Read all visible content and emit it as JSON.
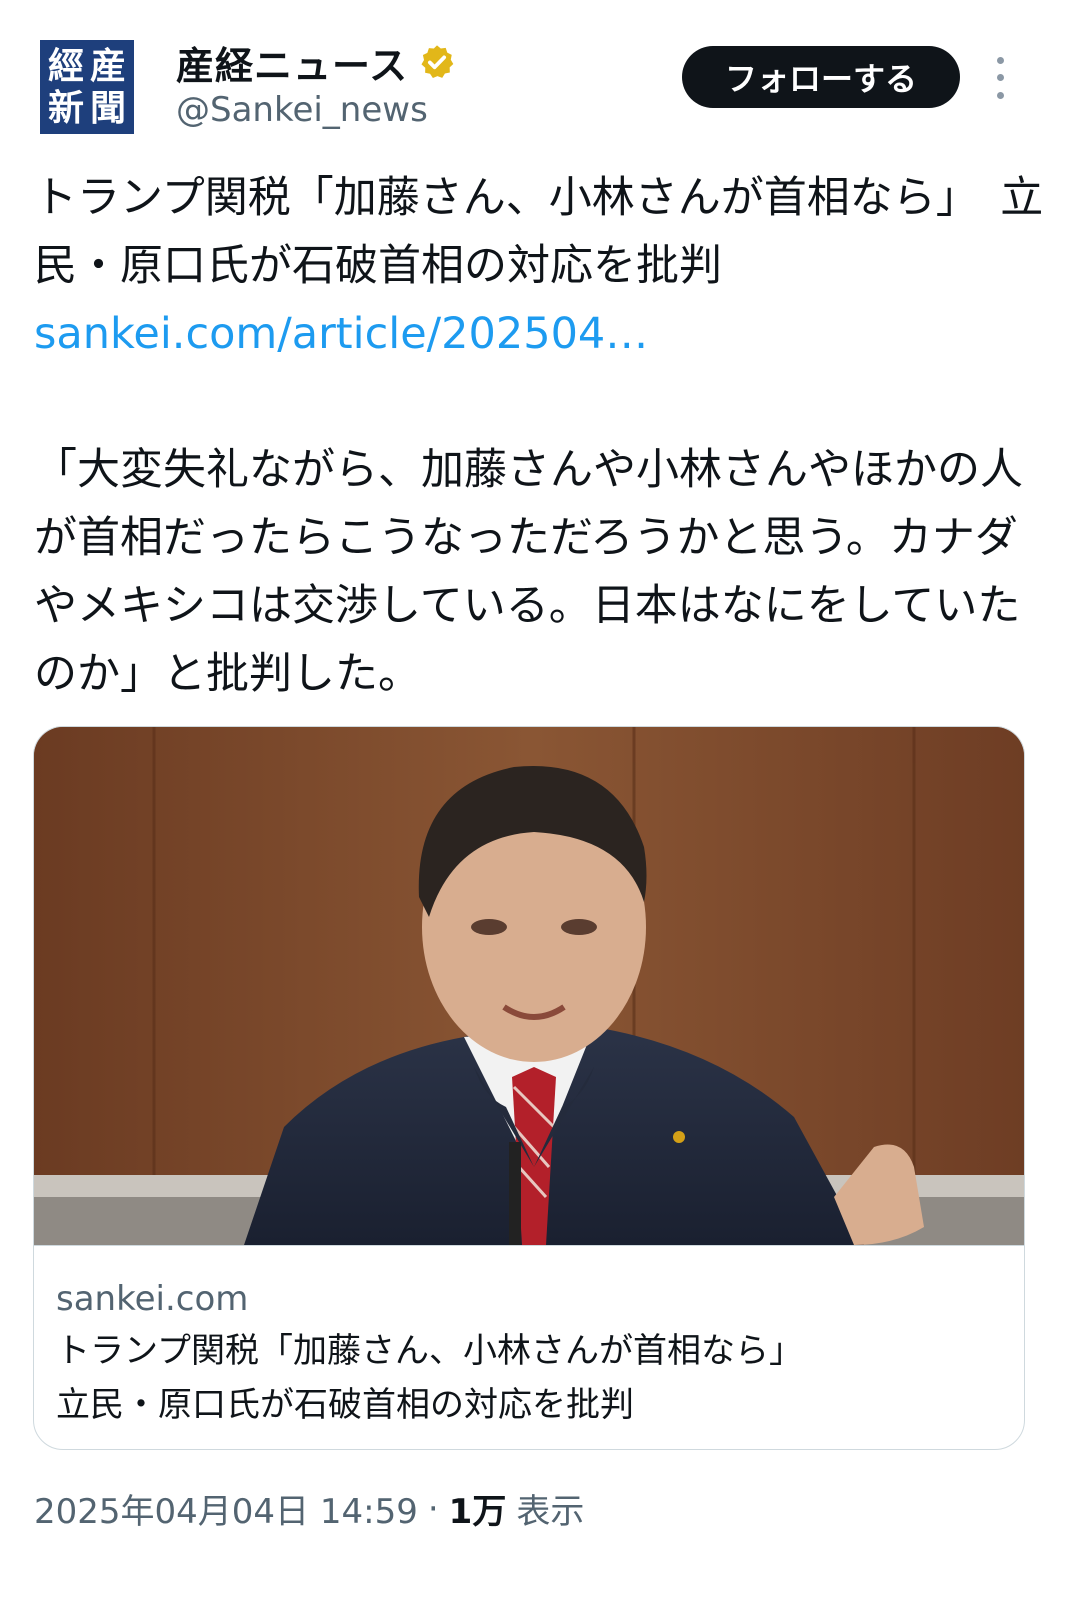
{
  "account": {
    "avatar_chars": [
      "産",
      "經",
      "新",
      "聞"
    ],
    "display_name": "産経ニュース",
    "handle": "@Sankei_news",
    "verified_badge_icon": "verified-badge-icon",
    "badge_color": "#e2b719"
  },
  "actions": {
    "follow_label": "フォローする",
    "more_icon": "more-options-icon"
  },
  "tweet": {
    "line1": "トランプ関税「加藤さん、小林さんが首相なら」　立民・原口氏が石破首相の対応を批判",
    "link_text": "sankei.com/article/202504…",
    "quote": "「大変失礼ながら、加藤さんや小林さんやほかの人が首相だったらこうなっただろうかと思う。カナダやメキシコは交渉している。日本はなにをしていたのか」と批判した。"
  },
  "card": {
    "image_alt": "原口氏の写真",
    "domain": "sankei.com",
    "title": "トランプ関税「加藤さん、小林さんが首相なら」\n立民・原口氏が石破首相の対応を批判"
  },
  "meta": {
    "timestamp": "2025年04月04日 14:59",
    "separator": "·",
    "views_count": "1万",
    "views_label": "表示"
  },
  "colors": {
    "link": "#1d9bf0",
    "secondary_text": "#536471",
    "avatar_bg": "#1e3f7c"
  }
}
